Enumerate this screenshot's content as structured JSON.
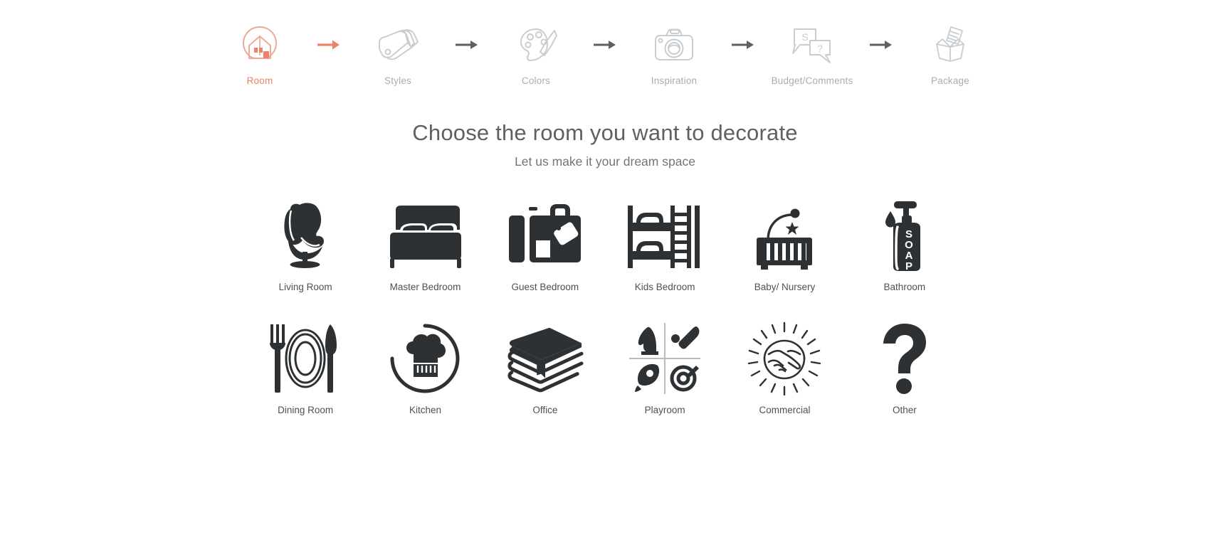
{
  "stepper": {
    "active_step": "Room",
    "steps": [
      {
        "label": "Room",
        "icon": "house-in-circle-icon",
        "state": "active"
      },
      {
        "label": "Styles",
        "icon": "fabric-swatch-icon",
        "state": "inactive"
      },
      {
        "label": "Colors",
        "icon": "paint-palette-icon",
        "state": "inactive"
      },
      {
        "label": "Inspiration",
        "icon": "camera-icon",
        "state": "inactive"
      },
      {
        "label": "Budget/Comments",
        "icon": "speech-bubbles-icon",
        "state": "inactive"
      },
      {
        "label": "Package",
        "icon": "open-box-icon",
        "state": "inactive"
      }
    ],
    "arrows": [
      {
        "icon": "arrow-right-icon",
        "state": "active"
      },
      {
        "icon": "arrow-right-icon",
        "state": "inactive"
      },
      {
        "icon": "arrow-right-icon",
        "state": "inactive"
      },
      {
        "icon": "arrow-right-icon",
        "state": "inactive"
      },
      {
        "icon": "arrow-right-icon",
        "state": "inactive"
      }
    ]
  },
  "headings": {
    "title": "Choose the room you want to decorate",
    "subtitle": "Let us make it your dream space"
  },
  "rooms": [
    {
      "label": "Living Room",
      "icon": "egg-chair-icon"
    },
    {
      "label": "Master Bedroom",
      "icon": "double-bed-icon"
    },
    {
      "label": "Guest Bedroom",
      "icon": "suitcase-icon"
    },
    {
      "label": "Kids Bedroom",
      "icon": "bunk-bed-icon"
    },
    {
      "label": "Baby/ Nursery",
      "icon": "crib-icon"
    },
    {
      "label": "Bathroom",
      "icon": "soap-dispenser-icon"
    },
    {
      "label": "Dining Room",
      "icon": "plate-fork-knife-icon"
    },
    {
      "label": "Kitchen",
      "icon": "chef-hat-icon"
    },
    {
      "label": "Office",
      "icon": "book-stack-icon"
    },
    {
      "label": "Playroom",
      "icon": "toys-quadrant-icon"
    },
    {
      "label": "Commercial",
      "icon": "handshake-icon"
    },
    {
      "label": "Other",
      "icon": "question-mark-icon"
    }
  ],
  "colors": {
    "accent": "#f0806a",
    "icon_dark": "#2d3134",
    "step_inactive": "#c7ccd1",
    "arrow_inactive": "#5c6166",
    "label_text": "#4c5156",
    "title_text": "#5c6166",
    "background": "#ffffff"
  }
}
